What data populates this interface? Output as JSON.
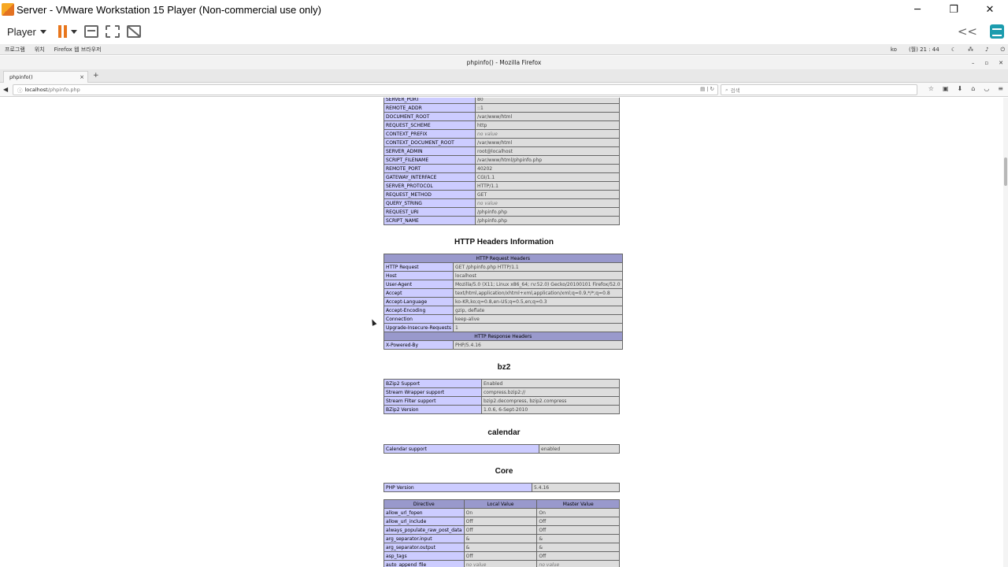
{
  "vmware": {
    "title": "Server - VMware Workstation 15 Player (Non-commercial use only)",
    "player_menu": "Player",
    "min": "─",
    "restore": "❐",
    "close": "✕",
    "collapse_icon": "<<"
  },
  "gnome": {
    "programs": "프로그램",
    "places": "위치",
    "app": "Firefox 웹 브라우저",
    "lang": "ko",
    "clock": "(월) 21 : 44"
  },
  "firefox": {
    "window_title": "phpinfo() - Mozilla Firefox",
    "tab_title": "phpinfo()",
    "tab_close": "×",
    "new_tab": "+",
    "url_host": "localhost",
    "url_path": "/phpinfo.php",
    "search_placeholder": "검색",
    "back": "◀"
  },
  "server_rows": [
    {
      "k": "SERVER_PORT",
      "v": "80"
    },
    {
      "k": "REMOTE_ADDR",
      "v": "::1"
    },
    {
      "k": "DOCUMENT_ROOT",
      "v": "/var/www/html"
    },
    {
      "k": "REQUEST_SCHEME",
      "v": "http"
    },
    {
      "k": "CONTEXT_PREFIX",
      "v": "no value"
    },
    {
      "k": "CONTEXT_DOCUMENT_ROOT",
      "v": "/var/www/html"
    },
    {
      "k": "SERVER_ADMIN",
      "v": "root@localhost"
    },
    {
      "k": "SCRIPT_FILENAME",
      "v": "/var/www/html/phpinfo.php"
    },
    {
      "k": "REMOTE_PORT",
      "v": "40202"
    },
    {
      "k": "GATEWAY_INTERFACE",
      "v": "CGI/1.1"
    },
    {
      "k": "SERVER_PROTOCOL",
      "v": "HTTP/1.1"
    },
    {
      "k": "REQUEST_METHOD",
      "v": "GET"
    },
    {
      "k": "QUERY_STRING",
      "v": "no value"
    },
    {
      "k": "REQUEST_URI",
      "v": "/phpinfo.php"
    },
    {
      "k": "SCRIPT_NAME",
      "v": "/phpinfo.php"
    }
  ],
  "http_headers": {
    "title": "HTTP Headers Information",
    "request_header": "HTTP Request Headers",
    "request_rows": [
      {
        "k": "HTTP Request",
        "v": "GET /phpinfo.php HTTP/1.1"
      },
      {
        "k": "Host",
        "v": "localhost"
      },
      {
        "k": "User-Agent",
        "v": "Mozilla/5.0 (X11; Linux x86_64; rv:52.0) Gecko/20100101 Firefox/52.0"
      },
      {
        "k": "Accept",
        "v": "text/html,application/xhtml+xml,application/xml;q=0.9,*/*;q=0.8"
      },
      {
        "k": "Accept-Language",
        "v": "ko-KR,ko;q=0.8,en-US;q=0.5,en;q=0.3"
      },
      {
        "k": "Accept-Encoding",
        "v": "gzip, deflate"
      },
      {
        "k": "Connection",
        "v": "keep-alive"
      },
      {
        "k": "Upgrade-Insecure-Requests",
        "v": "1"
      }
    ],
    "response_header": "HTTP Response Headers",
    "response_rows": [
      {
        "k": "X-Powered-By",
        "v": "PHP/5.4.16"
      }
    ]
  },
  "bz2": {
    "title": "bz2",
    "rows": [
      {
        "k": "BZip2 Support",
        "v": "Enabled"
      },
      {
        "k": "Stream Wrapper support",
        "v": "compress.bzip2://"
      },
      {
        "k": "Stream Filter support",
        "v": "bzip2.decompress, bzip2.compress"
      },
      {
        "k": "BZip2 Version",
        "v": "1.0.6, 6-Sept-2010"
      }
    ]
  },
  "calendar": {
    "title": "calendar",
    "rows": [
      {
        "k": "Calendar support",
        "v": "enabled"
      }
    ]
  },
  "core": {
    "title": "Core",
    "version_row": {
      "k": "PHP Version",
      "v": "5.4.16"
    },
    "columns": [
      "Directive",
      "Local Value",
      "Master Value"
    ],
    "rows": [
      {
        "d": "allow_url_fopen",
        "l": "On",
        "m": "On"
      },
      {
        "d": "allow_url_include",
        "l": "Off",
        "m": "Off"
      },
      {
        "d": "always_populate_raw_post_data",
        "l": "Off",
        "m": "Off"
      },
      {
        "d": "arg_separator.input",
        "l": "&",
        "m": "&"
      },
      {
        "d": "arg_separator.output",
        "l": "&",
        "m": "&"
      },
      {
        "d": "asp_tags",
        "l": "Off",
        "m": "Off"
      },
      {
        "d": "auto_append_file",
        "l": "no value",
        "m": "no value"
      }
    ]
  }
}
